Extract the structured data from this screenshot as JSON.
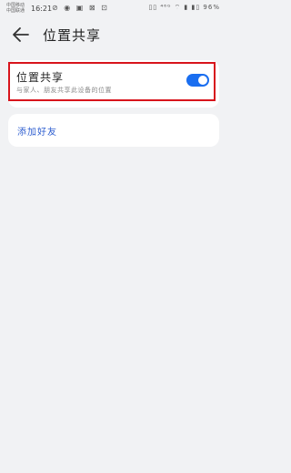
{
  "status_bar": {
    "carrier_line1": "中国移动",
    "carrier_line2": "中国联通",
    "time": "16:21",
    "left_icons_text": "⊘ ◉ ▣ ⊠ ⊡",
    "right_icons_text": "▯▯ ⁴⁶ᴳ ⌔ ▮ ▮▯ 96%"
  },
  "header": {
    "title": "位置共享",
    "back_icon": "back-arrow-icon"
  },
  "share_card": {
    "title": "位置共享",
    "description": "与家人、朋友共享此设备的位置",
    "toggle_on": true,
    "toggle_color": "#1a6ef0"
  },
  "add_card": {
    "label": "添加好友",
    "label_color": "#2f5fd0"
  },
  "colors": {
    "background": "#f1f2f4",
    "highlight_border": "#d8141c"
  }
}
